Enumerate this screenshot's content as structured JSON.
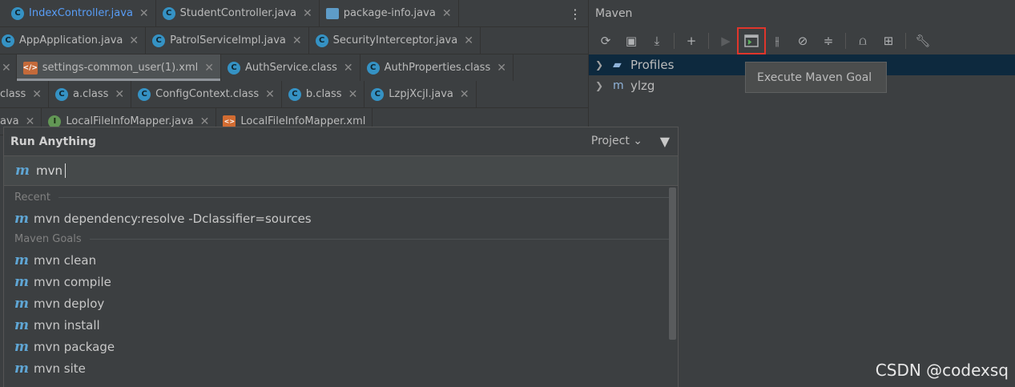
{
  "editor_tabs": {
    "row1": [
      {
        "label": "IndexController.java",
        "icon": "class-icon",
        "highlight": true
      },
      {
        "label": "StudentController.java",
        "icon": "class-icon"
      },
      {
        "label": "package-info.java",
        "icon": "package-icon"
      }
    ],
    "row2": [
      {
        "label": "AppApplication.java",
        "icon": "class-icon"
      },
      {
        "label": "PatrolServiceImpl.java",
        "icon": "class-icon"
      },
      {
        "label": "SecurityInterceptor.java",
        "icon": "class-icon"
      }
    ],
    "row3": [
      {
        "label": "settings-common_user(1).xml",
        "icon": "xml-icon",
        "active": true
      },
      {
        "label": "AuthService.class",
        "icon": "class-icon"
      },
      {
        "label": "AuthProperties.class",
        "icon": "class-icon"
      }
    ],
    "row4": [
      {
        "label": "class",
        "icon": "none"
      },
      {
        "label": "a.class",
        "icon": "class-icon"
      },
      {
        "label": "ConfigContext.class",
        "icon": "class-icon"
      },
      {
        "label": "b.class",
        "icon": "class-icon"
      },
      {
        "label": "LzpjXcjl.java",
        "icon": "class-icon"
      }
    ],
    "row5": [
      {
        "label": "ava",
        "icon": "none"
      },
      {
        "label": "LocalFileInfoMapper.java",
        "icon": "interface-icon"
      },
      {
        "label": "LocalFileInfoMapper.xml",
        "icon": "xml-icon"
      }
    ]
  },
  "maven": {
    "title": "Maven",
    "tree": [
      {
        "label": "Profiles",
        "selected": true
      },
      {
        "label": "ylzg",
        "selected": false
      }
    ],
    "tooltip": "Execute Maven Goal"
  },
  "run_anything": {
    "title": "Run Anything",
    "scope": "Project",
    "input_value": "mvn",
    "recent_header": "Recent",
    "recent": [
      "mvn dependency:resolve -Dclassifier=sources"
    ],
    "goals_header": "Maven Goals",
    "goals": [
      "mvn clean",
      "mvn compile",
      "mvn deploy",
      "mvn install",
      "mvn package",
      "mvn site"
    ]
  },
  "watermark": "CSDN @codexsq",
  "colors": {
    "accent": "#589df6",
    "selection": "#0d293e",
    "highlight_box": "#e0352b"
  }
}
